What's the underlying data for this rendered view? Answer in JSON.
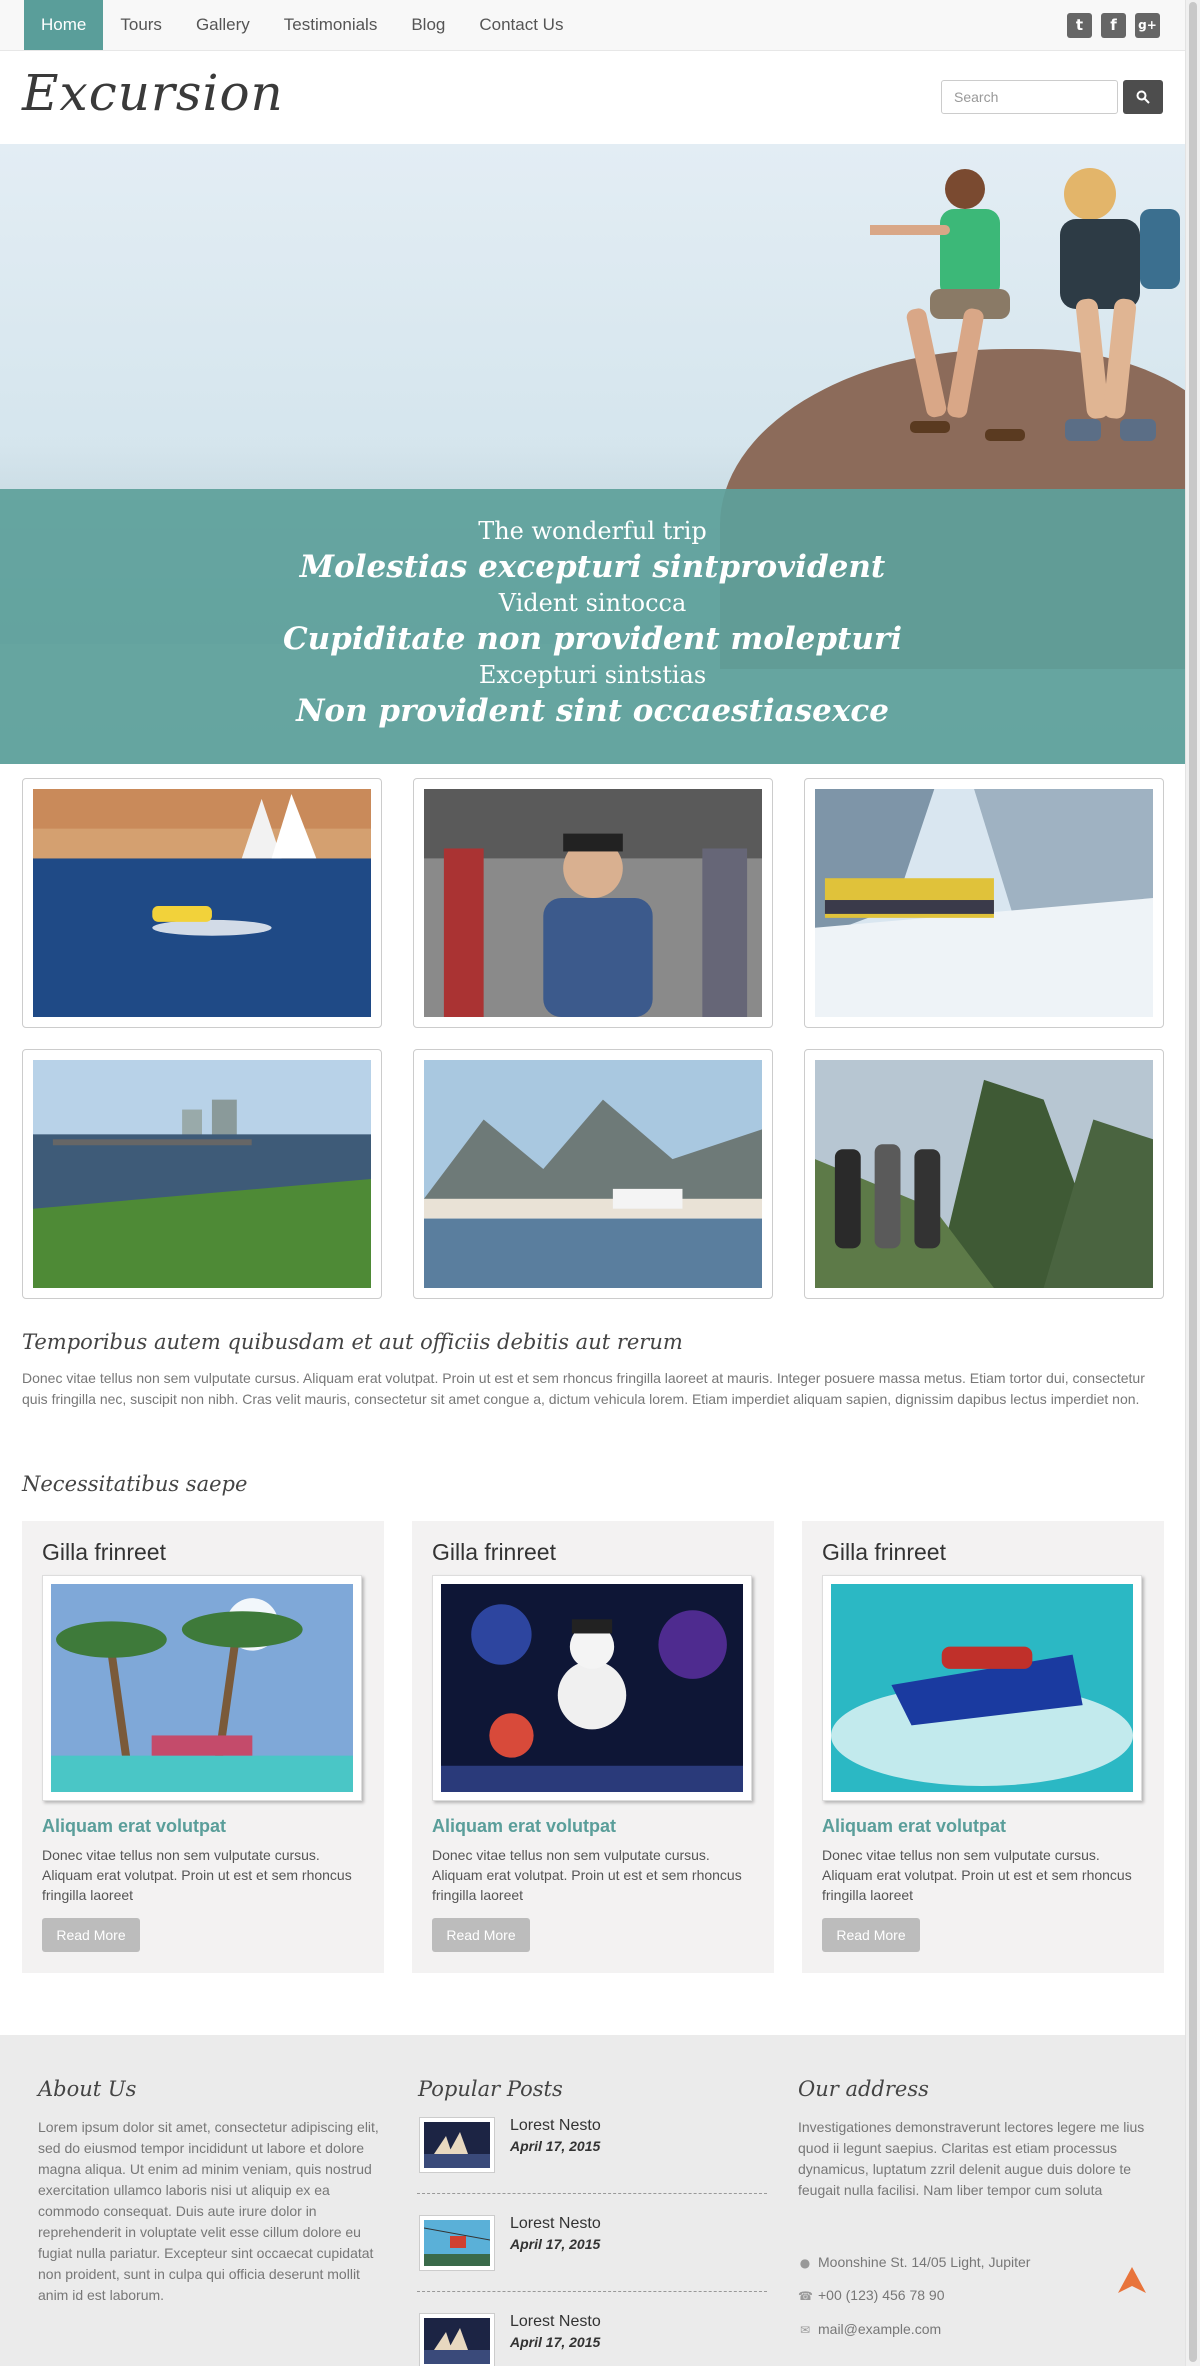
{
  "nav": {
    "items": [
      "Home",
      "Tours",
      "Gallery",
      "Testimonials",
      "Blog",
      "Contact Us"
    ],
    "social": [
      "t",
      "f",
      "g+"
    ]
  },
  "header": {
    "logo": "Excursion",
    "search_placeholder": "Search"
  },
  "hero": {
    "lines": [
      "The wonderful trip",
      "Molestias excepturi sintprovident",
      "Vident sintocca",
      "Cupiditate non provident molepturi",
      "Excepturi sintstias",
      "Non provident sint occaestiasexce"
    ]
  },
  "intro": {
    "title": "Temporibus autem quibusdam et aut officiis debitis aut rerum",
    "text": "Donec vitae tellus non sem vulputate cursus. Aliquam erat volutpat. Proin ut est et sem rhoncus fringilla laoreet at mauris. Integer posuere massa metus. Etiam tortor dui, consectetur quis fringilla nec, suscipit non nibh. Cras velit mauris, consectetur sit amet congue a, dictum vehicula lorem. Etiam imperdiet aliquam sapien, dignissim dapibus lectus imperdiet non."
  },
  "section_title": "Necessitatibus saepe",
  "cards": [
    {
      "title": "Gilla frinreet",
      "subtitle": "Aliquam erat volutpat",
      "text": "Donec vitae tellus non sem vulputate cursus. Aliquam erat volutpat. Proin ut est et sem rhoncus fringilla laoreet",
      "button": "Read More"
    },
    {
      "title": "Gilla frinreet",
      "subtitle": "Aliquam erat volutpat",
      "text": "Donec vitae tellus non sem vulputate cursus. Aliquam erat volutpat. Proin ut est et sem rhoncus fringilla laoreet",
      "button": "Read More"
    },
    {
      "title": "Gilla frinreet",
      "subtitle": "Aliquam erat volutpat",
      "text": "Donec vitae tellus non sem vulputate cursus. Aliquam erat volutpat. Proin ut est et sem rhoncus fringilla laoreet",
      "button": "Read More"
    }
  ],
  "footer": {
    "about": {
      "title": "About Us",
      "text": "Lorem ipsum dolor sit amet, consectetur adipiscing elit, sed do eiusmod tempor incididunt ut labore et dolore magna aliqua. Ut enim ad minim veniam, quis nostrud exercitation ullamco laboris nisi ut aliquip ex ea commodo consequat. Duis aute irure dolor in reprehenderit in voluptate velit esse cillum dolore eu fugiat nulla pariatur. Excepteur sint occaecat cupidatat non proident, sunt in culpa qui officia deserunt mollit anim id est laborum."
    },
    "posts": {
      "title": "Popular Posts",
      "items": [
        {
          "title": "Lorest Nesto",
          "date": "April 17, 2015"
        },
        {
          "title": "Lorest Nesto",
          "date": "April 17, 2015"
        },
        {
          "title": "Lorest Nesto",
          "date": "April 17, 2015"
        }
      ]
    },
    "address": {
      "title": "Our address",
      "text": "Investigationes demonstraverunt lectores legere me lius quod ii legunt saepius. Claritas est etiam processus dynamicus, luptatum zzril delenit augue duis dolore te feugait nulla facilisi. Nam liber tempor cum soluta",
      "location": "Moonshine St. 14/05 Light, Jupiter",
      "phone": "+00 (123) 456 78 90",
      "email": "mail@example.com"
    }
  },
  "colors": {
    "accent": "#5a9e9a",
    "nav_bg": "#f8f8f8",
    "card_bg": "#f3f2f2",
    "footer_bg": "#ebebeb",
    "button_gray": "#bcbcbc",
    "to_top_arrow": "#e8743b"
  },
  "icons": {
    "search": "search-icon",
    "location": "map-pin-icon",
    "phone": "phone-icon",
    "email": "envelope-icon",
    "to_top": "arrow-up-icon"
  }
}
